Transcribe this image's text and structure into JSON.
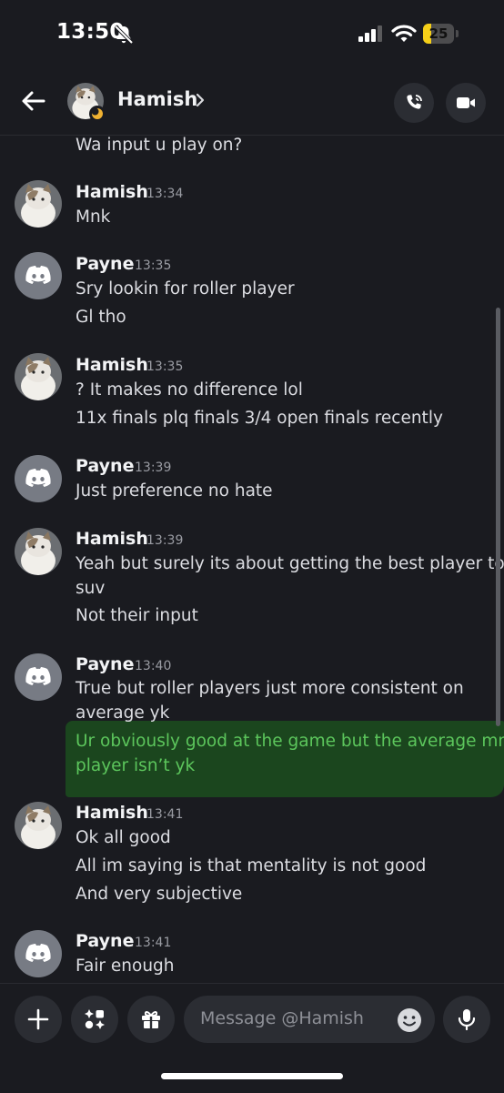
{
  "status_bar": {
    "time": "13:50",
    "battery": "25"
  },
  "header": {
    "name": "Hamish"
  },
  "messages": {
    "partial_line": "Wa input u play on?",
    "groups": [
      {
        "author": "Hamish",
        "time": "13:34",
        "lines": [
          "Mnk"
        ]
      },
      {
        "author": "Payne",
        "time": "13:35",
        "lines": [
          "Sry lookin for roller player",
          "Gl tho"
        ]
      },
      {
        "author": "Hamish",
        "time": "13:35",
        "lines": [
          "? It makes no difference lol",
          "11x finals plq finals 3/4 open finals recently"
        ]
      },
      {
        "author": "Payne",
        "time": "13:39",
        "lines": [
          "Just preference no hate"
        ]
      },
      {
        "author": "Hamish",
        "time": "13:39",
        "lines": [
          "Yeah but surely its about getting the best player to",
          "suv",
          "Not their input"
        ]
      },
      {
        "author": "Payne",
        "time": "13:40",
        "lines": [
          "True but roller players just more consistent on",
          "average yk",
          "Ur obviously good at the game but the average mnk",
          "player isn’t yk"
        ]
      },
      {
        "author": "Hamish",
        "time": "13:41",
        "lines": [
          "Ok all good",
          "All im saying is that mentality is not good",
          "And very subjective"
        ]
      },
      {
        "author": "Payne",
        "time": "13:41",
        "lines": [
          "Fair enough"
        ]
      }
    ]
  },
  "input": {
    "placeholder": "Message @Hamish"
  },
  "colors": {
    "background": "#1a1b20",
    "highlight": "#1e691e",
    "highlight_text": "#5cc65c",
    "battery": "#f5cf18"
  }
}
